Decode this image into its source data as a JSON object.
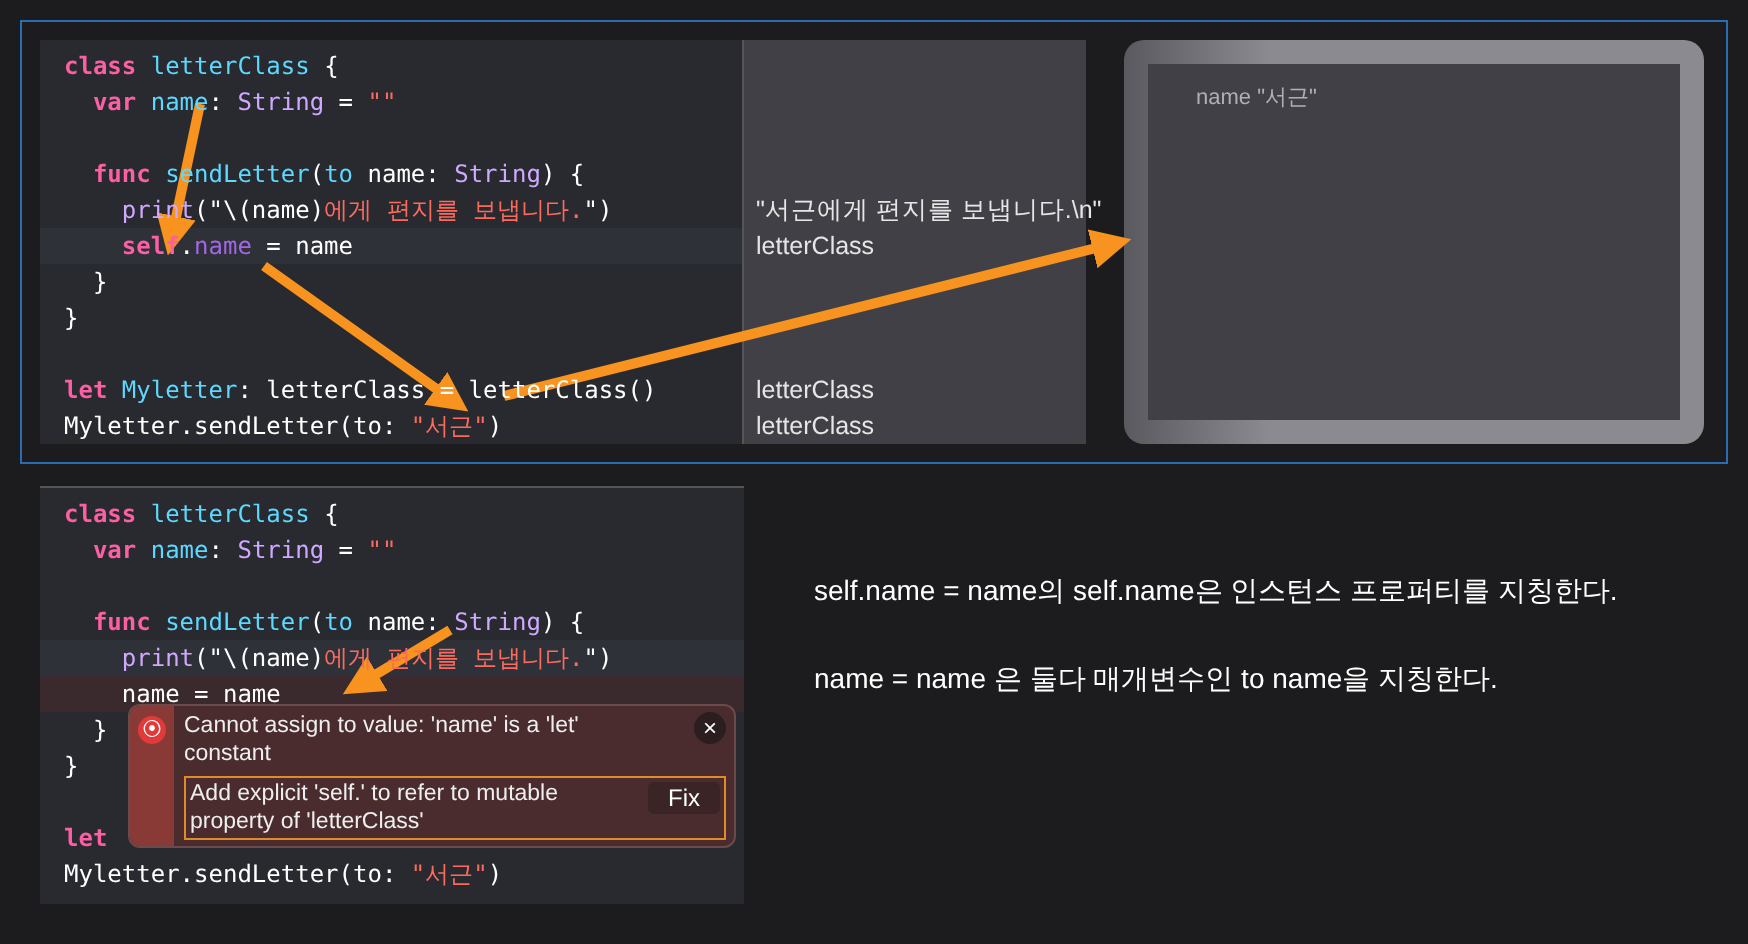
{
  "top_editor": {
    "lines": [
      {
        "kind": "plain",
        "tokens": [
          {
            "kind": "keyword",
            "s": "class "
          },
          {
            "kind": "decl",
            "s": "letterClass"
          },
          {
            "kind": "plain",
            "s": " {"
          }
        ]
      },
      {
        "kind": "plain",
        "tokens": [
          {
            "kind": "keyword",
            "s": "  var "
          },
          {
            "kind": "decl",
            "s": "name"
          },
          {
            "kind": "plain",
            "s": ": "
          },
          {
            "kind": "type",
            "s": "String"
          },
          {
            "kind": "plain",
            "s": " = "
          },
          {
            "kind": "string",
            "s": "\"\""
          }
        ]
      },
      {
        "kind": "plain"
      },
      {
        "kind": "plain",
        "tokens": [
          {
            "kind": "keyword",
            "s": "  func "
          },
          {
            "kind": "decl",
            "s": "sendLetter"
          },
          {
            "kind": "plain",
            "s": "("
          },
          {
            "kind": "decl",
            "s": "to"
          },
          {
            "kind": "plain",
            "s": " name: "
          },
          {
            "kind": "type",
            "s": "String"
          },
          {
            "kind": "plain",
            "s": ") {"
          }
        ]
      },
      {
        "kind": "plain",
        "result": "\"서근에게 편지를 보냅니다.\\n\"",
        "tokens": [
          {
            "kind": "type",
            "s": "    print"
          },
          {
            "kind": "plain",
            "s": "(\"\\(name)"
          },
          {
            "kind": "string",
            "s": "에게 편지를 보냅니다."
          },
          {
            "kind": "plain",
            "s": "\")"
          }
        ]
      },
      {
        "kind": "current",
        "result": "letterClass",
        "tokens": [
          {
            "kind": "keyword",
            "s": "    self"
          },
          {
            "kind": "plain",
            "s": "."
          },
          {
            "kind": "member",
            "s": "name"
          },
          {
            "kind": "plain",
            "s": " = name"
          }
        ]
      },
      {
        "kind": "plain",
        "tokens": [
          {
            "kind": "plain",
            "s": "  }"
          }
        ]
      },
      {
        "kind": "plain",
        "tokens": [
          {
            "kind": "plain",
            "s": "}"
          }
        ]
      },
      {
        "kind": "plain"
      },
      {
        "kind": "plain",
        "result": "letterClass",
        "tokens": [
          {
            "kind": "keyword",
            "s": "let "
          },
          {
            "kind": "decl",
            "s": "Myletter"
          },
          {
            "kind": "plain",
            "s": ": letterClass = letterClass()"
          }
        ]
      },
      {
        "kind": "plain",
        "result": "letterClass",
        "tokens": [
          {
            "kind": "plain",
            "s": "Myletter.sendLetter(to: "
          },
          {
            "kind": "string",
            "s": "\"서근\""
          },
          {
            "kind": "plain",
            "s": ")"
          }
        ]
      }
    ]
  },
  "preview": {
    "text": "name \"서근\""
  },
  "bottom_editor": {
    "lines": [
      {
        "kind": "plain",
        "tokens": [
          {
            "kind": "keyword",
            "s": "class "
          },
          {
            "kind": "decl",
            "s": "letterClass"
          },
          {
            "kind": "plain",
            "s": " {"
          }
        ]
      },
      {
        "kind": "plain",
        "tokens": [
          {
            "kind": "keyword",
            "s": "  var "
          },
          {
            "kind": "decl",
            "s": "name"
          },
          {
            "kind": "plain",
            "s": ": "
          },
          {
            "kind": "type",
            "s": "String"
          },
          {
            "kind": "plain",
            "s": " = "
          },
          {
            "kind": "string",
            "s": "\"\""
          }
        ]
      },
      {
        "kind": "plain"
      },
      {
        "kind": "plain",
        "tokens": [
          {
            "kind": "keyword",
            "s": "  func "
          },
          {
            "kind": "decl",
            "s": "sendLetter"
          },
          {
            "kind": "plain",
            "s": "("
          },
          {
            "kind": "decl",
            "s": "to"
          },
          {
            "kind": "plain",
            "s": " name: "
          },
          {
            "kind": "type",
            "s": "String"
          },
          {
            "kind": "plain",
            "s": ") {"
          }
        ]
      },
      {
        "kind": "current",
        "tokens": [
          {
            "kind": "type",
            "s": "    print"
          },
          {
            "kind": "plain",
            "s": "(\"\\(name)"
          },
          {
            "kind": "string",
            "s": "에게 편지를 보냅니다."
          },
          {
            "kind": "plain",
            "s": "\")"
          }
        ]
      },
      {
        "kind": "error",
        "tokens": [
          {
            "kind": "plain",
            "s": "    name = name"
          }
        ]
      },
      {
        "kind": "plain",
        "tokens": [
          {
            "kind": "plain",
            "s": "  }"
          }
        ]
      },
      {
        "kind": "plain",
        "tokens": [
          {
            "kind": "plain",
            "s": "}"
          }
        ]
      },
      {
        "kind": "plain"
      },
      {
        "kind": "plain",
        "tokens": [
          {
            "kind": "keyword",
            "s": "let"
          }
        ]
      },
      {
        "kind": "plain",
        "tokens": [
          {
            "kind": "plain",
            "s": "Myletter.sendLetter(to: "
          },
          {
            "kind": "string",
            "s": "\"서근\""
          },
          {
            "kind": "plain",
            "s": ")"
          }
        ]
      }
    ],
    "error_popup": {
      "icon": "⦿",
      "message": "Cannot assign to value: 'name' is a 'let' constant",
      "close": "×",
      "fix_text": "Add explicit 'self.' to refer to mutable property of 'letterClass'",
      "fix_button": "Fix"
    }
  },
  "notes": [
    "self.name = name의 self.name은 인스턴스 프로퍼티를 지칭한다.",
    "name = name 은 둘다 매개변수인 to name을 지칭한다."
  ]
}
